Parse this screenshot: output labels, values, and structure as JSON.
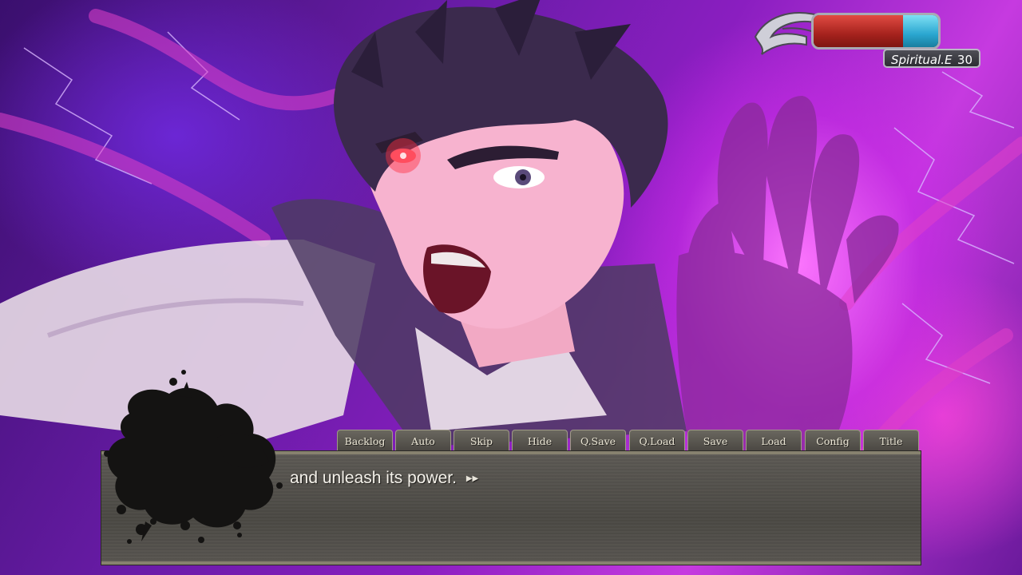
{
  "gauge": {
    "label": "Spiritual.E",
    "value": "30",
    "hp_fraction": 0.72,
    "colors": {
      "hp": "#c0302a",
      "energy": "#3ab5dd"
    }
  },
  "menu": {
    "tabs": [
      "Backlog",
      "Auto",
      "Skip",
      "Hide",
      "Q.Save",
      "Q.Load",
      "Save",
      "Load",
      "Config",
      "Title"
    ]
  },
  "dialog": {
    "text": "and unleash its power.",
    "advance_icon": "double-arrow-icon"
  },
  "portrait": {
    "icon": "ink-splat-icon"
  }
}
